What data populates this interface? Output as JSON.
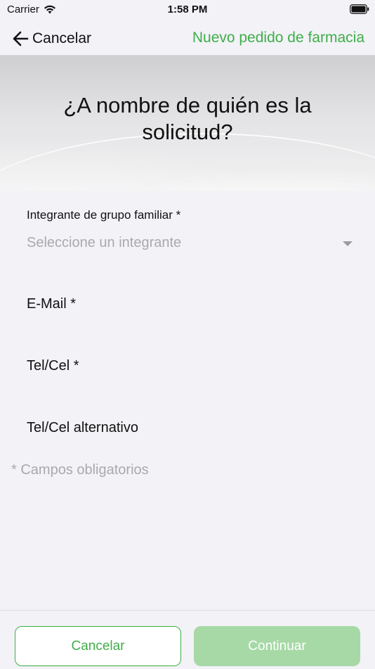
{
  "status_bar": {
    "carrier": "Carrier",
    "time": "1:58 PM"
  },
  "nav": {
    "back_label": "Cancelar",
    "title": "Nuevo pedido de farmacia"
  },
  "hero": {
    "title": "¿A nombre de quién es la solicitud?"
  },
  "form": {
    "member_label": "Integrante de grupo familiar *",
    "member_placeholder": "Seleccione un integrante",
    "email_label": "E-Mail *",
    "phone_label": "Tel/Cel *",
    "alt_phone_label": "Tel/Cel alternativo",
    "required_note": "* Campos obligatorios"
  },
  "actions": {
    "cancel_label": "Cancelar",
    "continue_label": "Continuar"
  },
  "colors": {
    "accent_green": "#3fae49",
    "disabled_green": "#a6d9a6",
    "placeholder_gray": "#a9a9ae",
    "background": "#f2f2f7"
  }
}
